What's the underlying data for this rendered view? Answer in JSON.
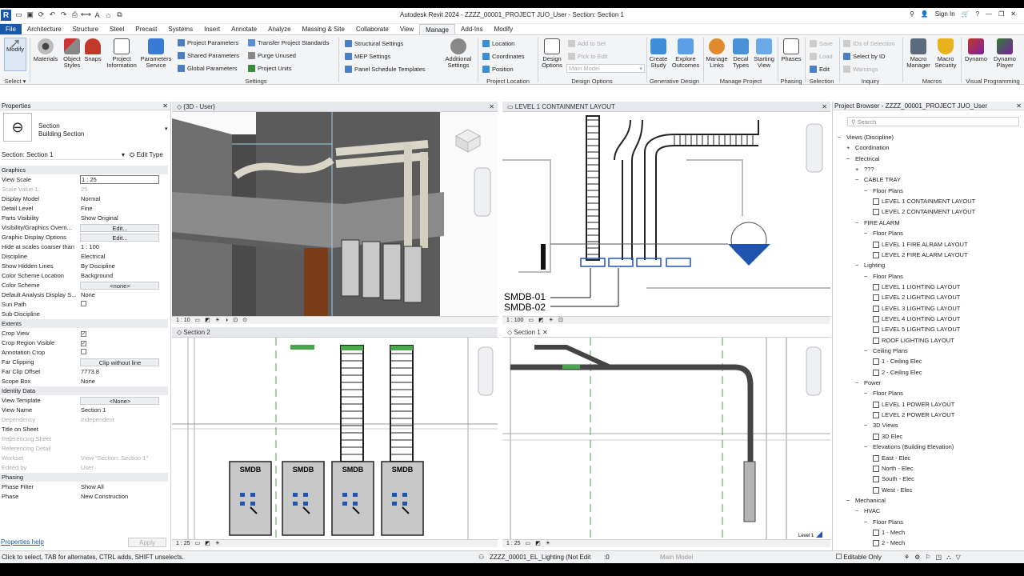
{
  "app": {
    "title": "Autodesk Revit 2024 - ZZZZ_00001_PROJECT JUO_User - Section: Section 1",
    "sign_in": "Sign In",
    "logo": "R"
  },
  "tabs": [
    "File",
    "Architecture",
    "Structure",
    "Steel",
    "Precast",
    "Systems",
    "Insert",
    "Annotate",
    "Analyze",
    "Massing & Site",
    "Collaborate",
    "View",
    "Manage",
    "Add-Ins",
    "Modify"
  ],
  "active_tab": "Manage",
  "ribbon": {
    "modify": "Modify",
    "select": "Select",
    "materials": "Materials",
    "object_styles": "Object\nStyles",
    "snaps": "Snaps",
    "project_information": "Project\nInformation",
    "parameters_service": "Parameters\nService",
    "settings_rows": [
      "Project  Parameters",
      "Shared  Parameters",
      "Global  Parameters"
    ],
    "settings_rows2": [
      "Transfer  Project Standards",
      "Purge  Unused",
      "Project  Units"
    ],
    "settings_label": "Settings",
    "struct_rows": [
      "Structural  Settings",
      "MEP  Settings",
      "Panel Schedule  Templates"
    ],
    "additional_settings": "Additional\nSettings",
    "location_rows": [
      "Location",
      "Coordinates",
      "Position"
    ],
    "project_location_label": "Project Location",
    "design_options": "Design\nOptions",
    "design_rows": [
      "Add to Set",
      "Pick to Edit"
    ],
    "main_model": "Main Model",
    "design_options_label": "Design Options",
    "create_study": "Create\nStudy",
    "explore_outcomes": "Explore\nOutcomes",
    "generative_label": "Generative Design",
    "manage_links": "Manage\nLinks",
    "decal_types": "Decal\nTypes",
    "starting_view": "Starting\nView",
    "manage_project_label": "Manage Project",
    "phases": "Phases",
    "phasing_label": "Phasing",
    "sel_rows": [
      "Save",
      "Load",
      "Edit"
    ],
    "selection_label": "Selection",
    "inq_rows": [
      "IDs of  Selection",
      "Select by ID",
      "Warnings"
    ],
    "inquiry_label": "Inquiry",
    "macro_manager": "Macro\nManager",
    "macro_security": "Macro\nSecurity",
    "macros_label": "Macros",
    "dynamo": "Dynamo",
    "dynamo_player": "Dynamo\nPlayer",
    "visual_label": "Visual Programming"
  },
  "properties": {
    "header": "Properties",
    "type_name": "Section",
    "type_sub": "Building Section",
    "instance": "Section: Section 1",
    "edit_type": "Edit Type",
    "groups": [
      {
        "name": "Graphics",
        "rows": [
          [
            "View Scale",
            "1 : 25"
          ],
          [
            "Scale Value    1:",
            "25"
          ],
          [
            "Display Model",
            "Normal"
          ],
          [
            "Detail Level",
            "Fine"
          ],
          [
            "Parts Visibility",
            "Show Original"
          ],
          [
            "Visibility/Graphics Overri...",
            "Edit..."
          ],
          [
            "Graphic Display Options",
            "Edit..."
          ],
          [
            "Hide at scales coarser than",
            "1 : 100"
          ],
          [
            "Discipline",
            "Electrical"
          ],
          [
            "Show Hidden Lines",
            "By Discipline"
          ],
          [
            "Color Scheme Location",
            "Background"
          ],
          [
            "Color Scheme",
            "<none>"
          ],
          [
            "Default Analysis Display S...",
            "None"
          ],
          [
            "Sun Path",
            ""
          ],
          [
            "Sub-Discipline",
            ""
          ]
        ]
      },
      {
        "name": "Extents",
        "rows": [
          [
            "Crop View",
            "✓"
          ],
          [
            "Crop Region Visible",
            "✓"
          ],
          [
            "Annotation Crop",
            ""
          ],
          [
            "Far Clipping",
            "Clip without line"
          ],
          [
            "Far Clip Offset",
            "7773.8"
          ],
          [
            "Scope Box",
            "None"
          ]
        ]
      },
      {
        "name": "Identity Data",
        "rows": [
          [
            "View Template",
            "<None>"
          ],
          [
            "View Name",
            "Section 1"
          ],
          [
            "Dependency",
            "Independent"
          ],
          [
            "Title on Sheet",
            ""
          ],
          [
            "Referencing Sheet",
            ""
          ],
          [
            "Referencing Detail",
            ""
          ],
          [
            "Workset",
            "View \"Section: Section 1\""
          ],
          [
            "Edited by",
            "User"
          ]
        ]
      },
      {
        "name": "Phasing",
        "rows": [
          [
            "Phase Filter",
            "Show All"
          ],
          [
            "Phase",
            "New Construction"
          ]
        ]
      }
    ],
    "help": "Properties help",
    "apply": "Apply"
  },
  "views": {
    "v1": {
      "title": "{3D - User}",
      "scale": "1 : 10"
    },
    "v2": {
      "title": "LEVEL 1  CONTAINMENT LAYOUT",
      "scale": "1 : 100",
      "label1": "SMDB-01",
      "label2": "SMDB-02"
    },
    "v3": {
      "title": "Section 2",
      "scale": "1 : 25",
      "panel_label": "SMDB"
    },
    "v4": {
      "title": "Section 1",
      "scale": "1 : 25",
      "level": "Level 1"
    }
  },
  "browser": {
    "header": "Project Browser - ZZZZ_00001_PROJECT JUO_User",
    "search": "Search",
    "items": [
      [
        "−",
        "Views (Discipline)",
        0,
        "f"
      ],
      [
        "+",
        "Coordination",
        1,
        "f"
      ],
      [
        "−",
        "Electrical",
        1,
        "f"
      ],
      [
        "+",
        "???",
        2,
        "f"
      ],
      [
        "−",
        "CABLE TRAY",
        2,
        "f"
      ],
      [
        "−",
        "Floor Plans",
        3,
        "f"
      ],
      [
        "",
        "LEVEL 1 CONTAINMENT LAYOUT",
        4,
        "v"
      ],
      [
        "",
        "LEVEL 2 CONTAINMENT LAYOUT",
        4,
        "v"
      ],
      [
        "−",
        "FIRE ALARM",
        2,
        "f"
      ],
      [
        "−",
        "Floor Plans",
        3,
        "f"
      ],
      [
        "",
        "LEVEL 1 FIRE ALRAM LAYOUT",
        4,
        "v"
      ],
      [
        "",
        "LEVEL 2 FIRE ALARM LAYOUT",
        4,
        "v"
      ],
      [
        "−",
        "Lighting",
        2,
        "f"
      ],
      [
        "−",
        "Floor Plans",
        3,
        "f"
      ],
      [
        "",
        "LEVEL 1 LIGHTING LAYOUT",
        4,
        "v"
      ],
      [
        "",
        "LEVEL 2 LIGHTING LAYOUT",
        4,
        "v"
      ],
      [
        "",
        "LEVEL 3 LIGHTING LAYOUT",
        4,
        "v"
      ],
      [
        "",
        "LEVEL 4 LIGHTING LAYOUT",
        4,
        "v"
      ],
      [
        "",
        "LEVEL 5 LIGHTING LAYOUT",
        4,
        "v"
      ],
      [
        "",
        "ROOF LIGHTING LAYOUT",
        4,
        "v"
      ],
      [
        "−",
        "Ceiling Plans",
        3,
        "f"
      ],
      [
        "",
        "1 - Ceiling Elec",
        4,
        "v"
      ],
      [
        "",
        "2 - Ceiling Elec",
        4,
        "v"
      ],
      [
        "−",
        "Power",
        2,
        "f"
      ],
      [
        "−",
        "Floor Plans",
        3,
        "f"
      ],
      [
        "",
        "LEVEL 1 POWER LAYOUT",
        4,
        "v"
      ],
      [
        "",
        "LEVEL 2 POWER LAYOUT",
        4,
        "v"
      ],
      [
        "−",
        "3D Views",
        3,
        "f"
      ],
      [
        "",
        "3D Elec",
        4,
        "v"
      ],
      [
        "−",
        "Elevations (Building Elevation)",
        3,
        "f"
      ],
      [
        "",
        "East - Elec",
        4,
        "v"
      ],
      [
        "",
        "North - Elec",
        4,
        "v"
      ],
      [
        "",
        "South - Elec",
        4,
        "v"
      ],
      [
        "",
        "West - Elec",
        4,
        "v"
      ],
      [
        "−",
        "Mechanical",
        1,
        "f"
      ],
      [
        "−",
        "HVAC",
        2,
        "f"
      ],
      [
        "−",
        "Floor Plans",
        3,
        "f"
      ],
      [
        "",
        "1 - Mech",
        4,
        "v"
      ],
      [
        "",
        "2 - Mech",
        4,
        "v"
      ]
    ]
  },
  "status": {
    "left": "Click to select, TAB for alternates, CTRL adds, SHIFT unselects.",
    "workset": "ZZZZ_00001_EL_Lighting (Not Edit",
    "zero": ":0",
    "model": "Main Model",
    "editable": "Editable Only"
  },
  "colors": {
    "accent": "#1858a8",
    "green": "#4aa64a",
    "blue": "#1f55b0"
  }
}
